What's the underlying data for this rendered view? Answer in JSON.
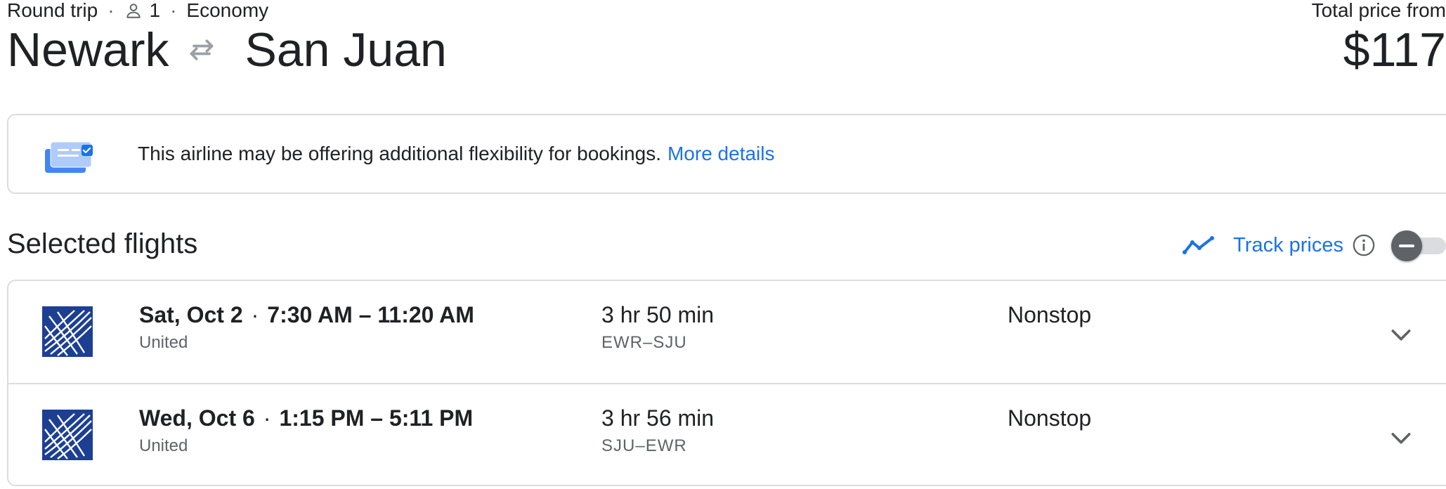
{
  "trip": {
    "type": "Round trip",
    "passengers": "1",
    "cabin": "Economy",
    "origin": "Newark",
    "destination": "San Juan"
  },
  "price": {
    "label": "Total price from",
    "value": "$117"
  },
  "banner": {
    "text": "This airline may be offering additional flexibility for bookings.",
    "link": "More details"
  },
  "selected_flights": {
    "title": "Selected flights",
    "track_label": "Track prices",
    "track_enabled": false
  },
  "flights": [
    {
      "date": "Sat, Oct 2",
      "times": "7:30 AM – 11:20 AM",
      "airline": "United",
      "duration": "3 hr 50 min",
      "route": "EWR–SJU",
      "stops": "Nonstop"
    },
    {
      "date": "Wed, Oct 6",
      "times": "1:15 PM – 5:11 PM",
      "airline": "United",
      "duration": "3 hr 56 min",
      "route": "SJU–EWR",
      "stops": "Nonstop"
    }
  ],
  "icons": {
    "person": "person-icon",
    "swap": "swap-arrows-icon",
    "banner": "ticket-card-check-icon",
    "trend": "trend-line-icon",
    "info": "info-icon",
    "airline_logo": "united-globe-logo",
    "expand": "chevron-down-icon"
  },
  "colors": {
    "link": "#1a73e8",
    "text": "#202124",
    "secondary_text": "#5f6368",
    "border": "#dadce0",
    "united_blue": "#1c3f94"
  }
}
